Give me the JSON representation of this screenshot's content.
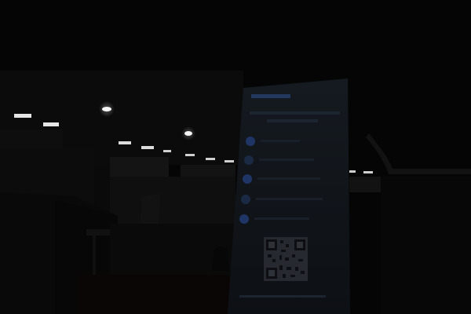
{
  "scene": {
    "description_visible": "",
    "colors": {
      "background": "#050505",
      "ceiling_light": "#f2f2f2",
      "banner_face": "#101418",
      "banner_accent_blue": "#2a4a8a"
    }
  },
  "banner": {
    "logo_text": "",
    "heading_line_1": "",
    "heading_line_2": "",
    "bottom_text": ""
  }
}
